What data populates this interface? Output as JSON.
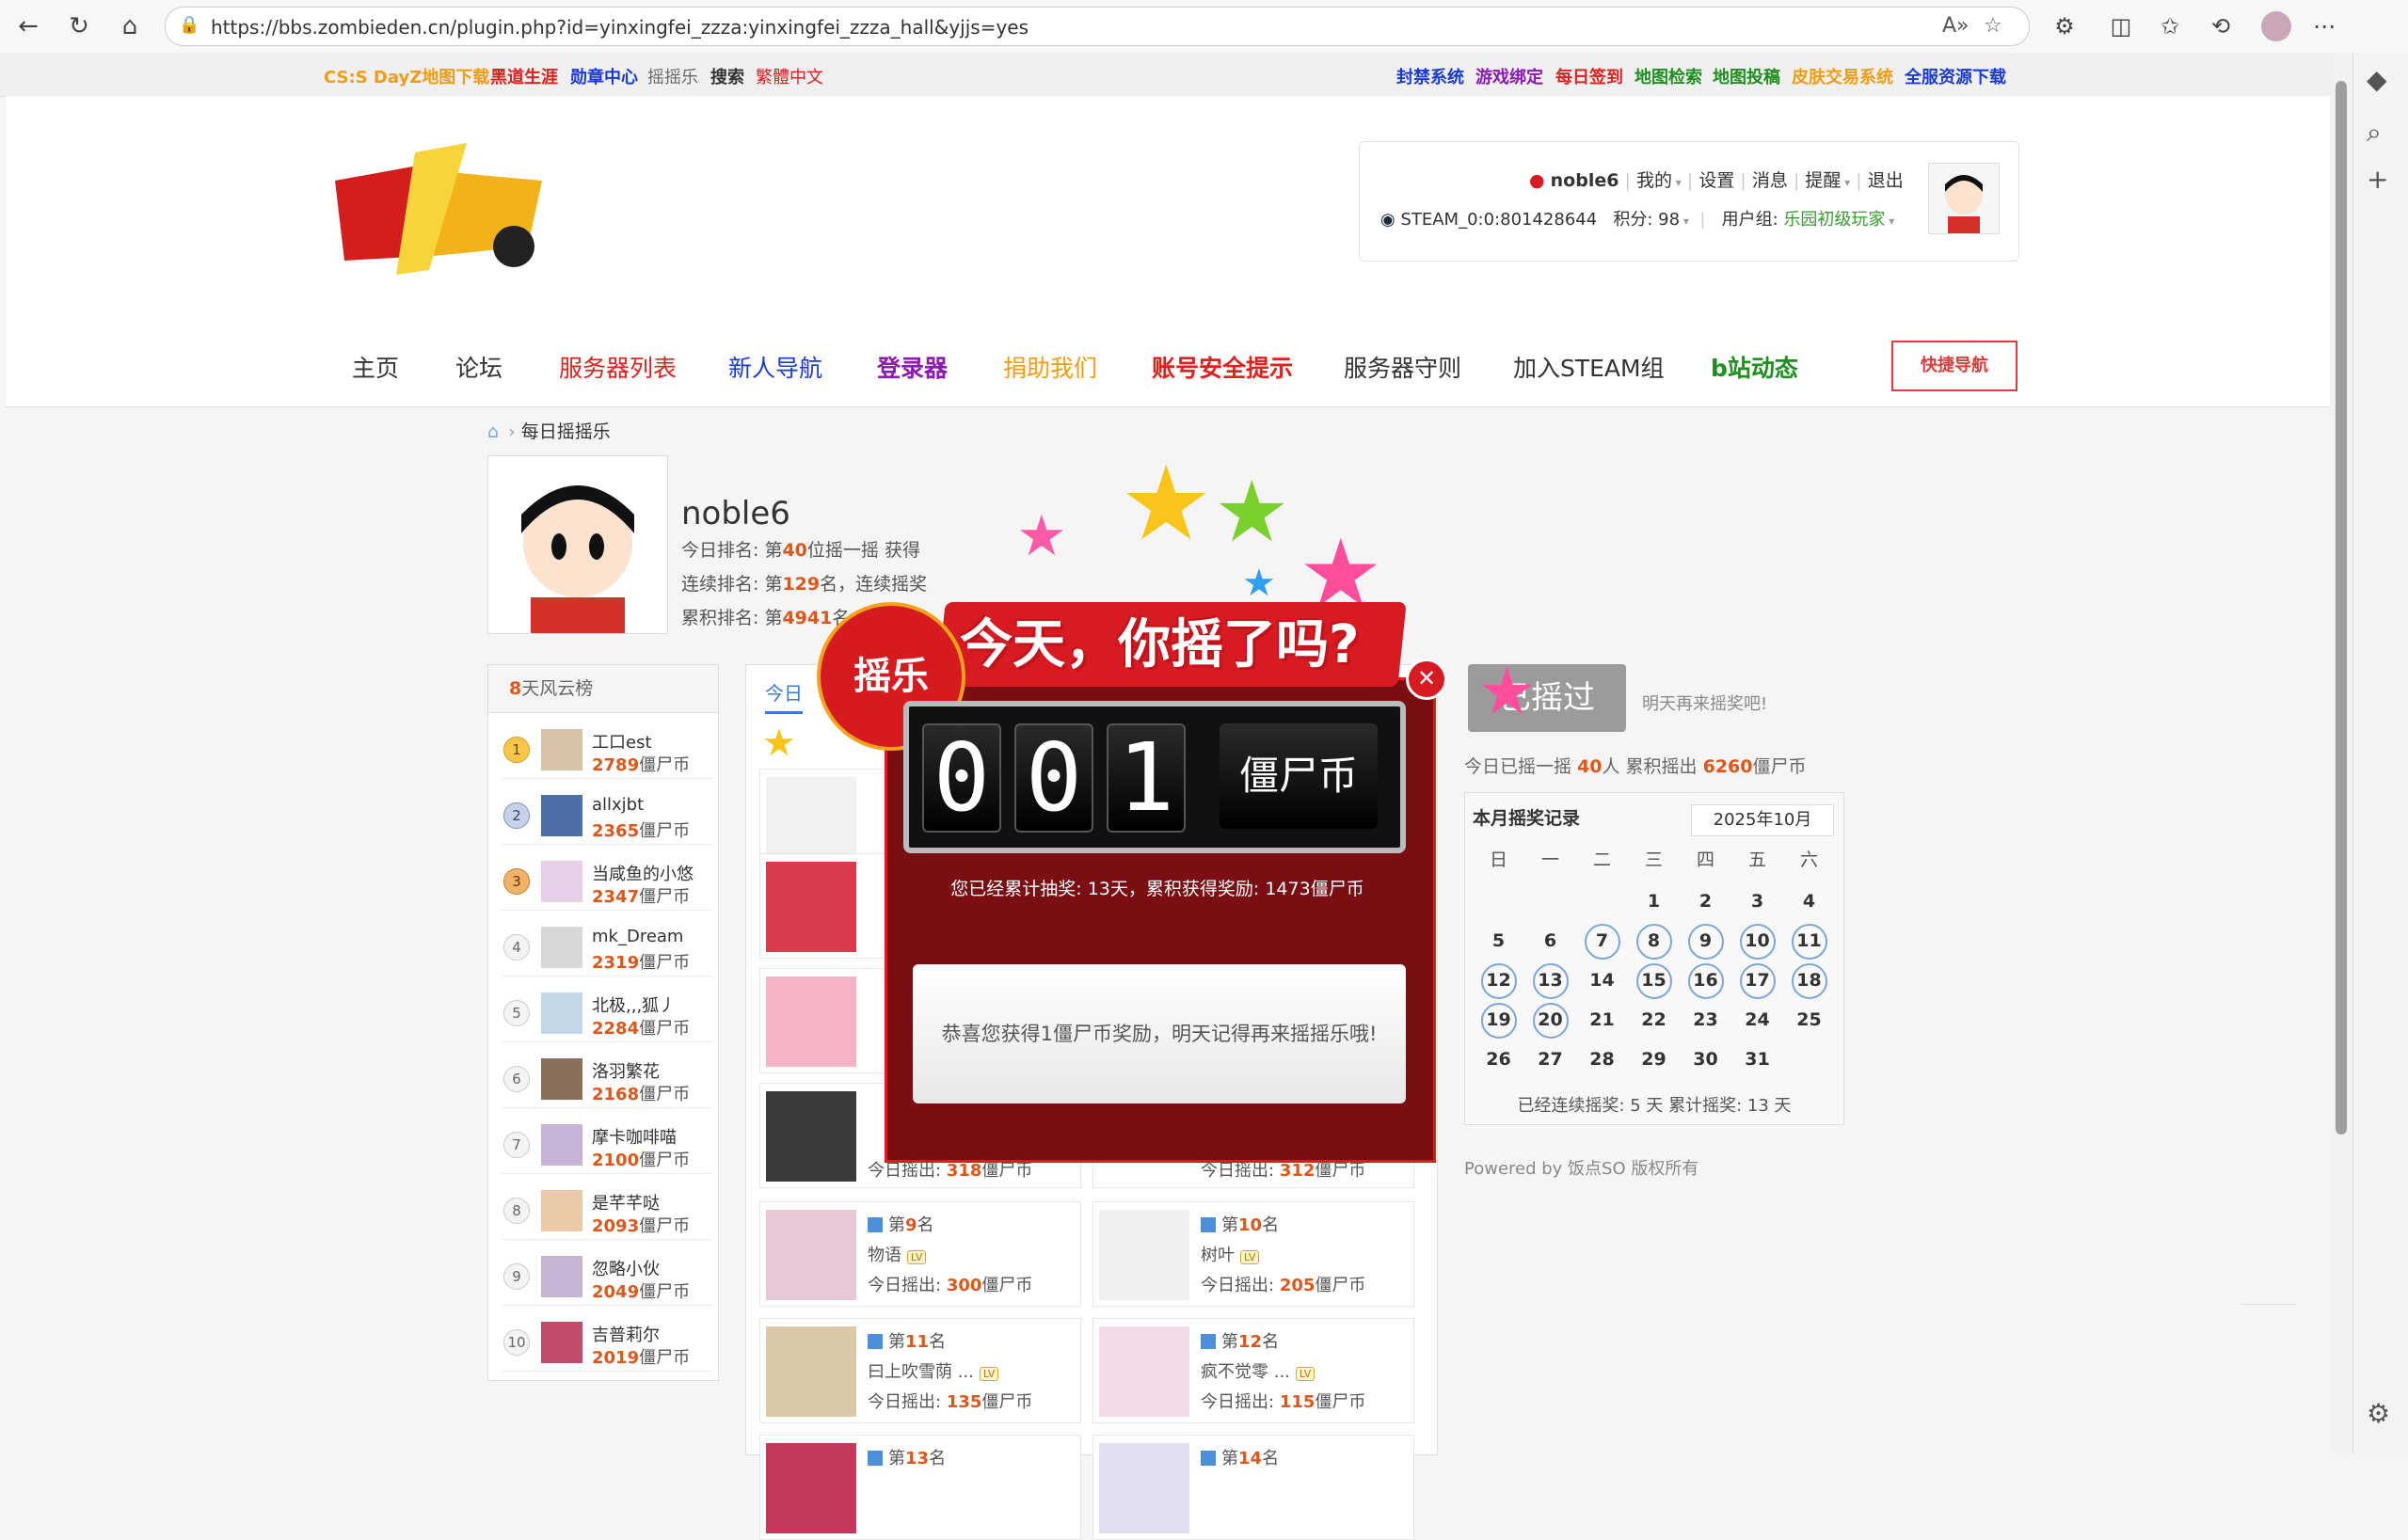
{
  "browser": {
    "url": "https://bbs.zombieden.cn/plugin.php?id=yinxingfei_zzza:yinxingfei_zzza_hall&yjjs=yes"
  },
  "toplinks": [
    {
      "label": "CS:S DayZ地图下载",
      "color": "#f39c12"
    },
    {
      "label": "黑道生涯",
      "color": "#e0201d"
    },
    {
      "label": "勋章中心",
      "color": "#1a3ad8"
    },
    {
      "label": "摇摇乐",
      "color": "#666666"
    },
    {
      "label": "搜索",
      "color": "#333333"
    },
    {
      "label": "繁體中文",
      "color": "#e0201d"
    },
    {
      "label": "封禁系统",
      "color": "#1a3ad8"
    },
    {
      "label": "游戏绑定",
      "color": "#8b1ab5"
    },
    {
      "label": "每日签到",
      "color": "#e0201d"
    },
    {
      "label": "地图检索",
      "color": "#1f8f1f"
    },
    {
      "label": "地图投稿",
      "color": "#1f8f1f"
    },
    {
      "label": "皮肤交易系统",
      "color": "#f39c12"
    },
    {
      "label": "全服资源下载",
      "color": "#1a3ad8"
    }
  ],
  "user": {
    "name": "noble6",
    "menu_mine": "我的",
    "menu_settings": "设置",
    "menu_messages": "消息",
    "menu_remind": "提醒",
    "menu_logout": "退出",
    "steam_id": "STEAM_0:0:801428644",
    "points": "积分: 98",
    "group_label": "用户组:",
    "group_value": "乐园初级玩家"
  },
  "mainnav": [
    {
      "label": "主页",
      "color": "#333333",
      "bold": false
    },
    {
      "label": "论坛",
      "color": "#333333",
      "bold": false
    },
    {
      "label": "服务器列表",
      "color": "#e0201d",
      "bold": false
    },
    {
      "label": "新人导航",
      "color": "#1a3ad8",
      "bold": false
    },
    {
      "label": "登录器",
      "color": "#8b1ab5",
      "bold": true
    },
    {
      "label": "捐助我们",
      "color": "#f39c12",
      "bold": false
    },
    {
      "label": "账号安全提示",
      "color": "#e0201d",
      "bold": true
    },
    {
      "label": "服务器守则",
      "color": "#333333",
      "bold": false
    },
    {
      "label": "加入STEAM组",
      "color": "#333333",
      "bold": false
    },
    {
      "label": "b站动态",
      "color": "#1f8f1f",
      "bold": true
    }
  ],
  "quick_nav": "快捷导航",
  "breadcrumb": "每日摇摇乐",
  "profile": {
    "name": "noble6",
    "line1_pre": "今日排名: 第",
    "line1_rank": "40",
    "line1_post": "位摇一摇 获得",
    "line2_pre": "连续排名: 第",
    "line2_rank": "129",
    "line2_post": "名，连续摇奖",
    "line3_pre": "累积排名: 第",
    "line3_rank": "4941",
    "line3_post": "名"
  },
  "ranklist": {
    "head_num": "8",
    "head_text": "天风云榜",
    "unit": "僵尸币",
    "rows": [
      {
        "rank": "1",
        "name": "工口est",
        "coins": "2789"
      },
      {
        "rank": "2",
        "name": "allxjbt",
        "coins": "2365"
      },
      {
        "rank": "3",
        "name": "当咸鱼的小悠",
        "coins": "2347"
      },
      {
        "rank": "4",
        "name": "mk_Dream",
        "coins": "2319"
      },
      {
        "rank": "5",
        "name": "北极,,,狐丿",
        "coins": "2284"
      },
      {
        "rank": "6",
        "name": "洛羽繁花",
        "coins": "2168"
      },
      {
        "rank": "7",
        "name": "摩卡咖啡喵",
        "coins": "2100"
      },
      {
        "rank": "8",
        "name": "是芊芊哒",
        "coins": "2093"
      },
      {
        "rank": "9",
        "name": "忽略小伙",
        "coins": "2049"
      },
      {
        "rank": "10",
        "name": "吉普莉尔",
        "coins": "2019"
      }
    ]
  },
  "midpanel": {
    "tab": "今日",
    "coin_label": "今日摇出:",
    "unit": "僵尸币",
    "cards": [
      {
        "rank_pre": "第",
        "rank": "9",
        "rank_post": "名",
        "name": "物语",
        "coins": "300"
      },
      {
        "rank_pre": "第",
        "rank": "10",
        "rank_post": "名",
        "name": "树叶",
        "coins": "205"
      },
      {
        "rank_pre": "第",
        "rank": "11",
        "rank_post": "名",
        "name": "曰上吹雪荫 ...",
        "coins": "135"
      },
      {
        "rank_pre": "第",
        "rank": "12",
        "rank_post": "名",
        "name": "疯不觉零 ...",
        "coins": "115"
      },
      {
        "rank_pre": "第",
        "rank": "13",
        "rank_post": "名",
        "name": "",
        "coins": ""
      },
      {
        "rank_pre": "第",
        "rank": "14",
        "rank_post": "名",
        "name": "",
        "coins": ""
      }
    ],
    "partial_coins_left": "318",
    "partial_coins_right": "312"
  },
  "right": {
    "badge": "已摇过",
    "note": "明天再来摇奖吧!",
    "stat_pre": "今日已摇一摇",
    "stat_people": "40",
    "stat_mid": "人 累积摇出",
    "stat_total": "6260",
    "stat_unit": "僵尸币",
    "calendar_title": "本月摇奖记录",
    "calendar_month": "2025年10月",
    "weekdays": [
      "日",
      "一",
      "二",
      "三",
      "四",
      "五",
      "六"
    ],
    "calendar_footer": "已经连续摇奖:  5 天  累计摇奖:  13 天",
    "powered": "Powered by 饭点SO 版权所有"
  },
  "calendar_days": {
    "first_weekday": 3,
    "days_in_month": 31,
    "marked": [
      7,
      8,
      9,
      10,
      11,
      12,
      13,
      15,
      16,
      17,
      18,
      19,
      20
    ]
  },
  "modal": {
    "circle_text": "摇乐",
    "banner": "今天，你摇了吗?",
    "digits": [
      "0",
      "0",
      "1"
    ],
    "coin_label": "僵尸币",
    "total": "您已经累计抽奖: 13天，累积获得奖励: 1473僵尸币",
    "message": "恭喜您获得1僵尸币奖励，明天记得再来摇摇乐哦!"
  }
}
